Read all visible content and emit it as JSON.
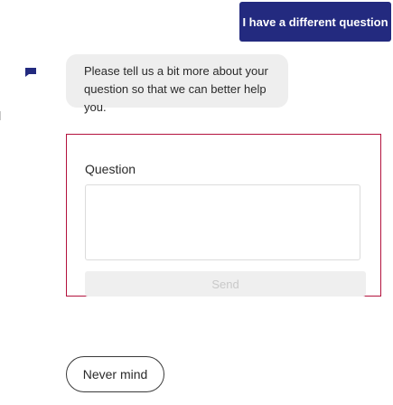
{
  "user_reply": {
    "label": "I have a different question"
  },
  "bot_message": {
    "text": "Please tell us a bit more about your question so that we can better help you."
  },
  "question_form": {
    "label": "Question",
    "textarea_value": "",
    "send_label": "Send"
  },
  "actions": {
    "never_mind_label": "Never mind"
  },
  "icons": {
    "avatar": "chat-bot-icon"
  },
  "colors": {
    "accent": "#232a7f",
    "form_border": "#b3123d",
    "bubble_bg": "#eeeeee"
  }
}
